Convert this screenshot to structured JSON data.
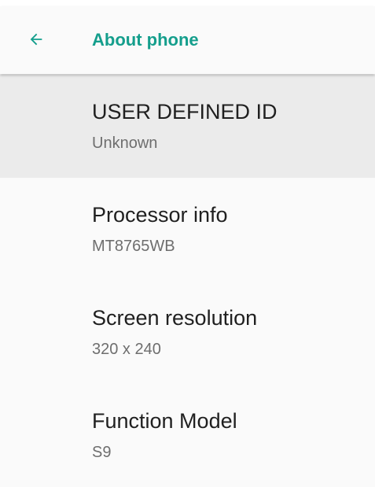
{
  "app_bar": {
    "title": "About phone",
    "back_icon": "arrow-back-icon",
    "accent_color": "#149e8c"
  },
  "items": [
    {
      "title": "USER DEFINED ID",
      "summary": "Unknown",
      "selected": true
    },
    {
      "title": "Processor info",
      "summary": "MT8765WB",
      "selected": false
    },
    {
      "title": "Screen resolution",
      "summary": "320 x 240",
      "selected": false
    },
    {
      "title": "Function Model",
      "summary": "S9",
      "selected": false
    }
  ]
}
